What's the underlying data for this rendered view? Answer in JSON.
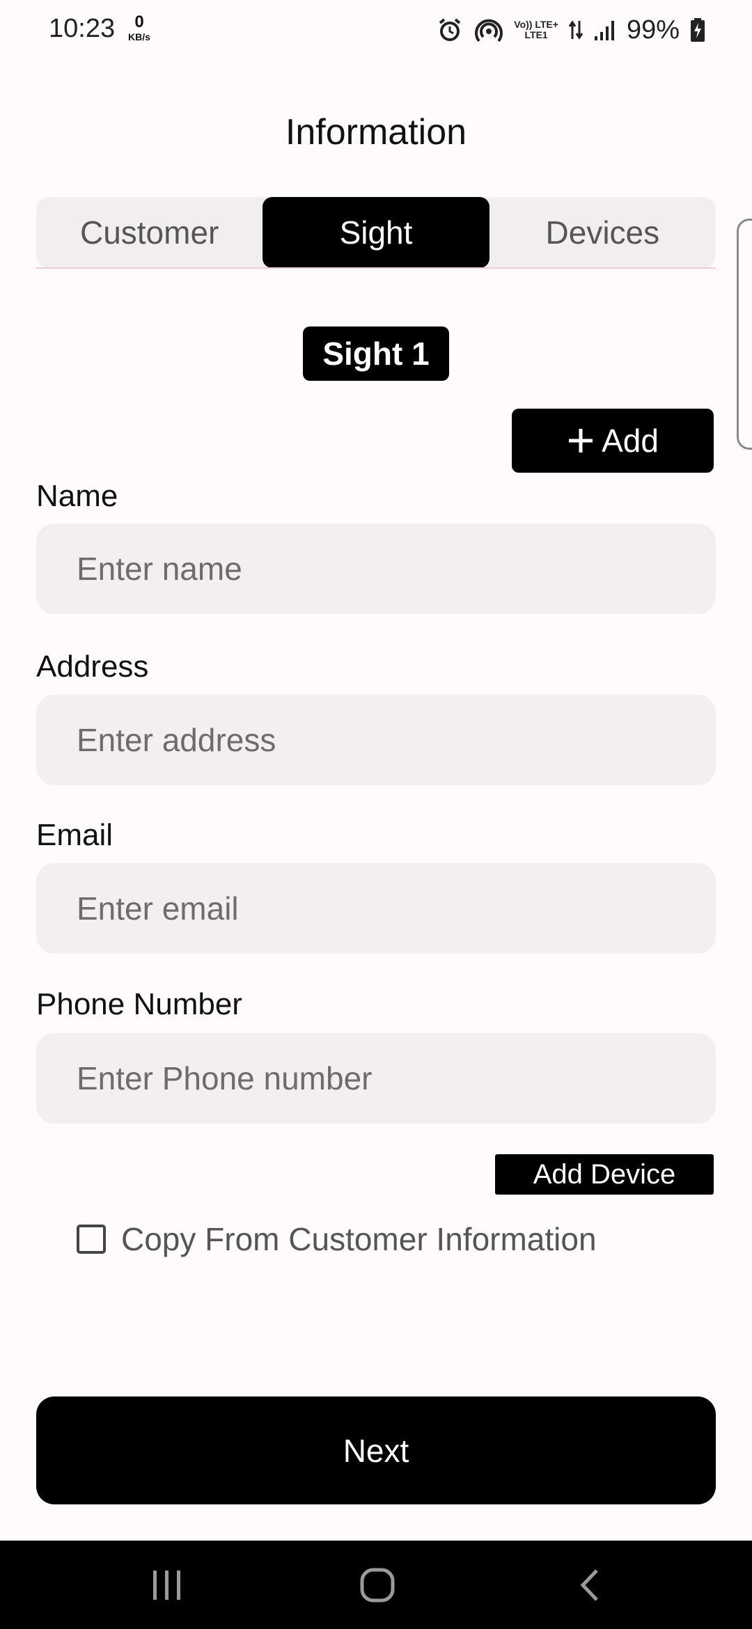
{
  "status_bar": {
    "time": "10:23",
    "data_speed_value": "0",
    "data_speed_unit": "KB/s",
    "volte_label": "Vo)) LTE+",
    "lte_label": "LTE1",
    "battery": "99%"
  },
  "page": {
    "title": "Information"
  },
  "tabs": [
    {
      "label": "Customer",
      "active": false
    },
    {
      "label": "Sight",
      "active": true
    },
    {
      "label": "Devices",
      "active": false
    }
  ],
  "sight": {
    "badge": "Sight 1",
    "add_label": "Add"
  },
  "form": {
    "name": {
      "label": "Name",
      "placeholder": "Enter name",
      "value": ""
    },
    "address": {
      "label": "Address",
      "placeholder": "Enter address",
      "value": ""
    },
    "email": {
      "label": "Email",
      "placeholder": "Enter email",
      "value": ""
    },
    "phone": {
      "label": "Phone Number",
      "placeholder": "Enter Phone number",
      "value": ""
    }
  },
  "add_device_label": "Add Device",
  "copy_checkbox": {
    "label": "Copy From Customer Information",
    "checked": false
  },
  "next_label": "Next",
  "colors": {
    "background": "#fffbfd",
    "primary": "#000000",
    "input_background": "#f3eef1",
    "tab_background": "#f1edf0"
  }
}
